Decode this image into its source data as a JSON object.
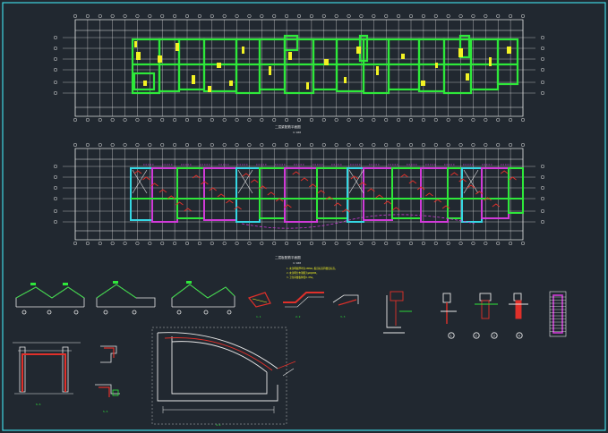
{
  "drawing": {
    "background": "#212830",
    "frame_color": "#3fd6e0",
    "colors": {
      "axis": "#e8e8e8",
      "wall": "#2ee83a",
      "beam_yellow": "#f2f224",
      "rebar_red": "#e0302a",
      "magenta": "#d03ad8",
      "cyan": "#35d7e3",
      "grey": "#9a9a9a"
    },
    "plan_top": {
      "caption": "二层梁配筋平面图",
      "scale": "1:100"
    },
    "plan_bottom": {
      "caption": "二层板配筋平面图",
      "scale": "1:100"
    },
    "notes": [
      "1.未注明板厚均为100mm,板顶标高同楼层标高。",
      "2.未注明分布钢筋为φ6@200。",
      "3.卫生间楼板降低0.05m。"
    ],
    "details": {
      "node_a": "1-1",
      "node_b": "2-2",
      "node_c": "3-3",
      "circle_labels": [
        "1",
        "2",
        "3",
        "4"
      ],
      "section_big": "4-4",
      "section_small": "5-5",
      "frame_section": "6-6"
    }
  }
}
